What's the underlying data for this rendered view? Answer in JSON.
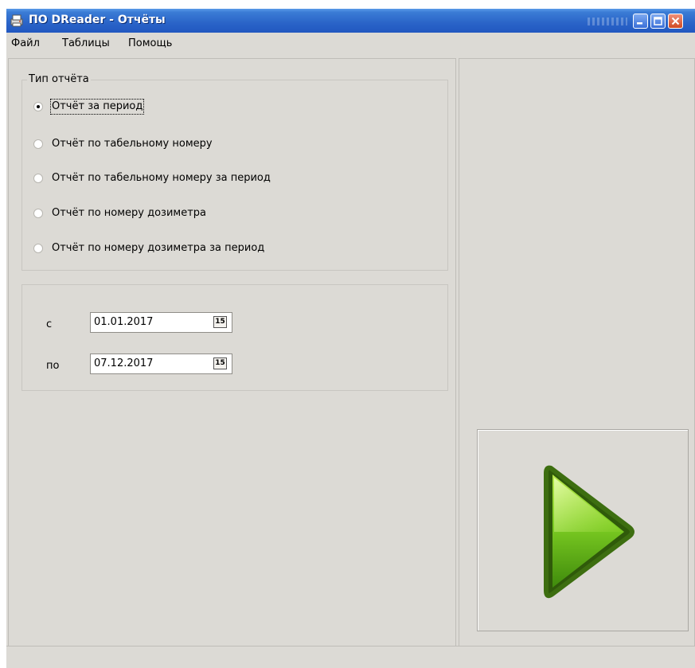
{
  "window": {
    "title": "ПО DReader - Отчёты",
    "minimize_glyph": "▬",
    "maximize_glyph": "□",
    "close_glyph": "✕"
  },
  "menu": {
    "items": [
      "Файл",
      "Таблицы",
      "Помощь"
    ]
  },
  "report_type": {
    "caption": "Тип отчёта",
    "options": [
      "Отчёт за период",
      "Отчёт по табельному номеру",
      "Отчёт по табельному номеру за период",
      "Отчёт по номеру дозиметра",
      "Отчёт по номеру дозиметра за период"
    ],
    "selected_index": 0
  },
  "period": {
    "from_label": "с",
    "from_value": "01.01.2017",
    "to_label": "по",
    "to_value": "07.12.2017",
    "calendar_glyph": "15"
  },
  "icons": {
    "app": "printer-icon",
    "run": "play-arrow-icon",
    "calendar": "calendar-icon"
  },
  "colors": {
    "titlebar": "#2a64c8",
    "window_bg": "#dcdad5",
    "arrow_green": "#6ec02a"
  }
}
